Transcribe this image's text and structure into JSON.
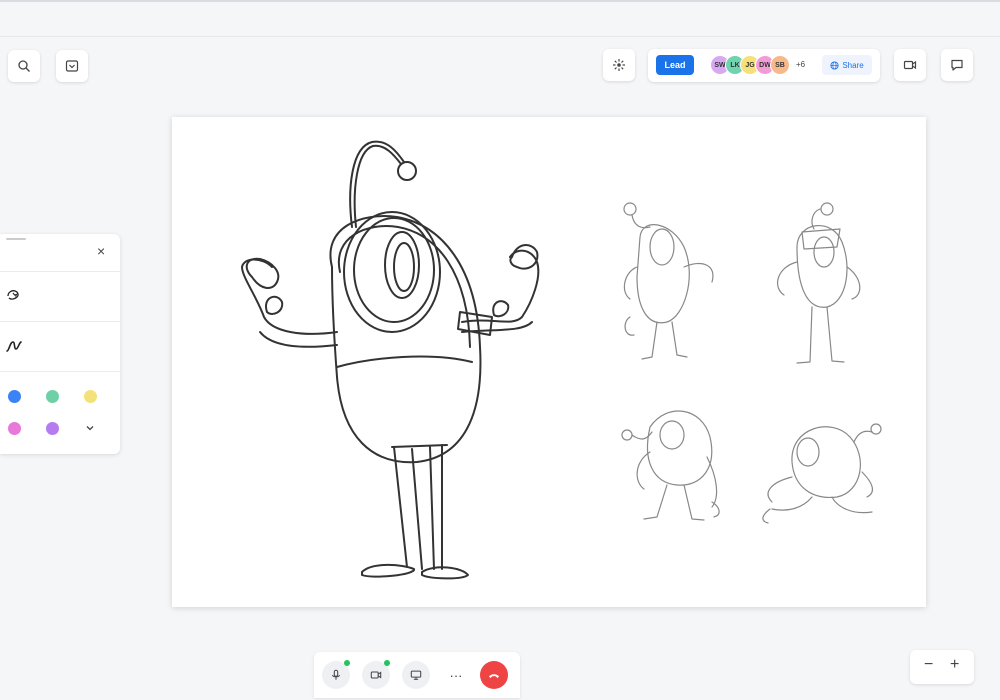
{
  "header": {
    "lead_label": "Lead",
    "share_label": "Share",
    "extra_collaborators": "+6",
    "collaborators": [
      {
        "initials": "SW",
        "color": "#d8a9f0"
      },
      {
        "initials": "LK",
        "color": "#6fd3b0"
      },
      {
        "initials": "JG",
        "color": "#f5e07a"
      },
      {
        "initials": "DW",
        "color": "#f39bd6"
      },
      {
        "initials": "SB",
        "color": "#f7b98a"
      }
    ]
  },
  "icons": {
    "search": "search-icon",
    "download": "download-icon",
    "laser": "laser-pointer-icon",
    "video": "video-icon",
    "chat": "chat-icon",
    "close": "close-icon",
    "shape_tool": "shape-recognition-icon",
    "pen_tool": "pen-icon",
    "mic": "mic-icon",
    "camera": "camera-icon",
    "present": "present-icon",
    "more": "more-icon",
    "hangup": "hang-up-icon",
    "chevron": "chevron-down-icon"
  },
  "tool_panel": {
    "close_label": "×",
    "colors": [
      "#3b82f6",
      "#6fcfa6",
      "#f3e27a",
      "#e879d9",
      "#b57cf0"
    ]
  },
  "call_controls": {
    "more_label": "···"
  },
  "zoom": {
    "out_label": "−",
    "in_label": "+"
  },
  "colors": {
    "accent": "#1a73e8",
    "hangup": "#ef4444",
    "status_on": "#22c55e"
  }
}
